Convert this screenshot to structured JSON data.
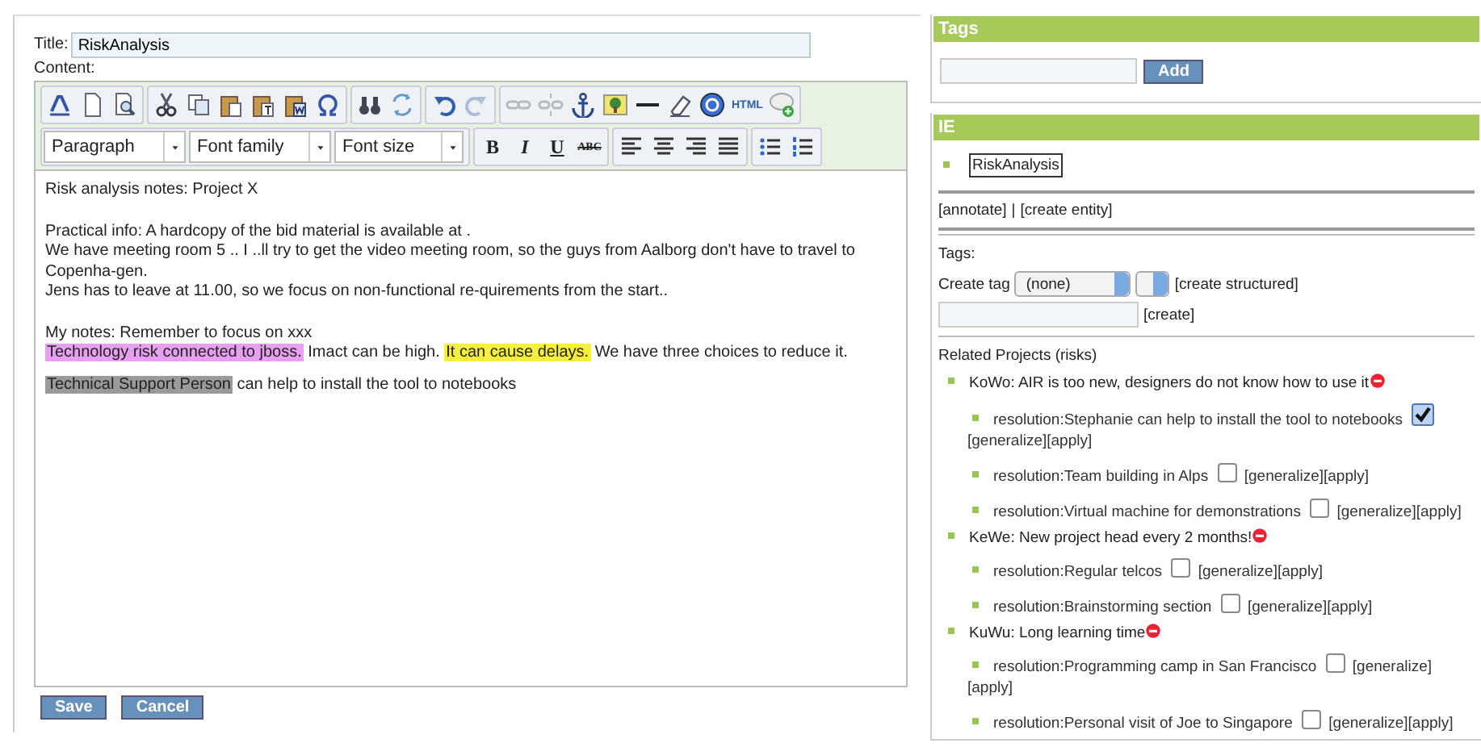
{
  "editor": {
    "title_label": "Title:",
    "title_value": "RiskAnalysis",
    "content_label": "Content:",
    "toolbar_row_1": [
      [
        {
          "kind": "icon",
          "disabled": false
        },
        {
          "kind": "icon",
          "disabled": false
        },
        {
          "kind": "icon",
          "disabled": false
        }
      ],
      [
        {
          "kind": "icon",
          "disabled": false
        },
        {
          "kind": "icon",
          "disabled": false
        },
        {
          "kind": "icon",
          "disabled": false
        },
        {
          "kind": "icon",
          "disabled": false
        },
        {
          "kind": "icon",
          "disabled": false
        },
        {
          "kind": "icon",
          "disabled": false
        }
      ],
      [
        {
          "kind": "icon",
          "disabled": false
        },
        {
          "kind": "icon",
          "disabled": false
        }
      ],
      [
        {
          "kind": "icon",
          "disabled": false
        },
        {
          "kind": "icon",
          "disabled": true
        }
      ],
      [
        {
          "kind": "icon",
          "disabled": true
        },
        {
          "kind": "icon",
          "disabled": true
        },
        {
          "kind": "icon",
          "disabled": false
        },
        {
          "kind": "icon",
          "disabled": false
        },
        {
          "kind": "icon",
          "disabled": false
        },
        {
          "kind": "icon",
          "disabled": false
        },
        {
          "kind": "icon",
          "disabled": false
        },
        {
          "kind": "text",
          "label": "HTML",
          "disabled": false
        },
        {
          "kind": "icon",
          "disabled": false
        }
      ]
    ],
    "selects": [
      "Paragraph",
      "Font family",
      "Font size"
    ],
    "format_buttons": [
      "B",
      "I",
      "U",
      "ABC"
    ],
    "blocks": [
      [
        [
          {
            "text": "Risk analysis notes: Project X"
          }
        ]
      ],
      [
        [
          {
            "text": "Practical info: A hardcopy of the bid material is available at ."
          }
        ],
        [
          {
            "text": "We have meeting room 5 .. I ..ll try to get the video meeting room, so the guys from Aalborg don't have to travel to Copenha-gen."
          }
        ],
        [
          {
            "text": "Jens has to leave at 11.00, so we focus on non-functional re-quirements from the start.."
          }
        ]
      ],
      [
        [
          {
            "text": "My notes: Remember to focus on xxx"
          }
        ],
        [
          {
            "text": "Technology risk connected to jboss.",
            "color": "#e7a0f0"
          },
          {
            "text": " Imact can be high. "
          },
          {
            "text": "It can cause delays.",
            "color": "#f6f03c"
          },
          {
            "text": " We have three choices to reduce it."
          }
        ]
      ],
      [
        [
          {
            "text": "Technical Support Person",
            "color": "#9a9a9a"
          },
          {
            "text": " can help to install the tool to notebooks"
          }
        ]
      ]
    ],
    "buttons": [
      "Save",
      "Cancel"
    ]
  },
  "tags_panel": {
    "header": "Tags",
    "button": "Add"
  },
  "ie_panel": {
    "header": "IE",
    "entity": "RiskAnalysis",
    "actions": [
      "[annotate]",
      "|",
      "[create entity]"
    ],
    "tags_label": "Tags:",
    "create_tag_label": "Create tag",
    "tag_select": "(none)",
    "create_structured": "[create structured]",
    "create": "[create]",
    "related_label": "Related Projects (risks)",
    "projects": [
      {
        "text": "KoWo: AIR is too new, designers do not know how to use it",
        "children": [
          {
            "text": "resolution:Stephanie can help to install the tool to notebooks",
            "checked": true,
            "links": [
              "[generalize]",
              "[apply]"
            ]
          },
          {
            "text": "resolution:Team building in Alps",
            "checked": false,
            "links": [
              "[generalize]",
              "[apply]"
            ]
          },
          {
            "text": "resolution:Virtual machine for demonstrations",
            "checked": false,
            "links": [
              "[generalize]",
              "[apply]"
            ]
          }
        ]
      },
      {
        "text": "KeWe: New project head every 2 months!",
        "children": [
          {
            "text": "resolution:Regular telcos",
            "checked": false,
            "links": [
              "[generalize]",
              "[apply]"
            ]
          },
          {
            "text": "resolution:Brainstorming section",
            "checked": false,
            "links": [
              "[generalize]",
              "[apply]"
            ]
          }
        ]
      },
      {
        "text": "KuWu: Long learning time",
        "children": [
          {
            "text": "resolution:Programming camp in San Francisco",
            "checked": false,
            "links": [
              "[generalize]",
              "[apply]"
            ]
          },
          {
            "text": "resolution:Personal visit of Joe to Singapore",
            "checked": false,
            "links": [
              "[generalize]",
              "[apply]"
            ]
          }
        ]
      }
    ]
  }
}
